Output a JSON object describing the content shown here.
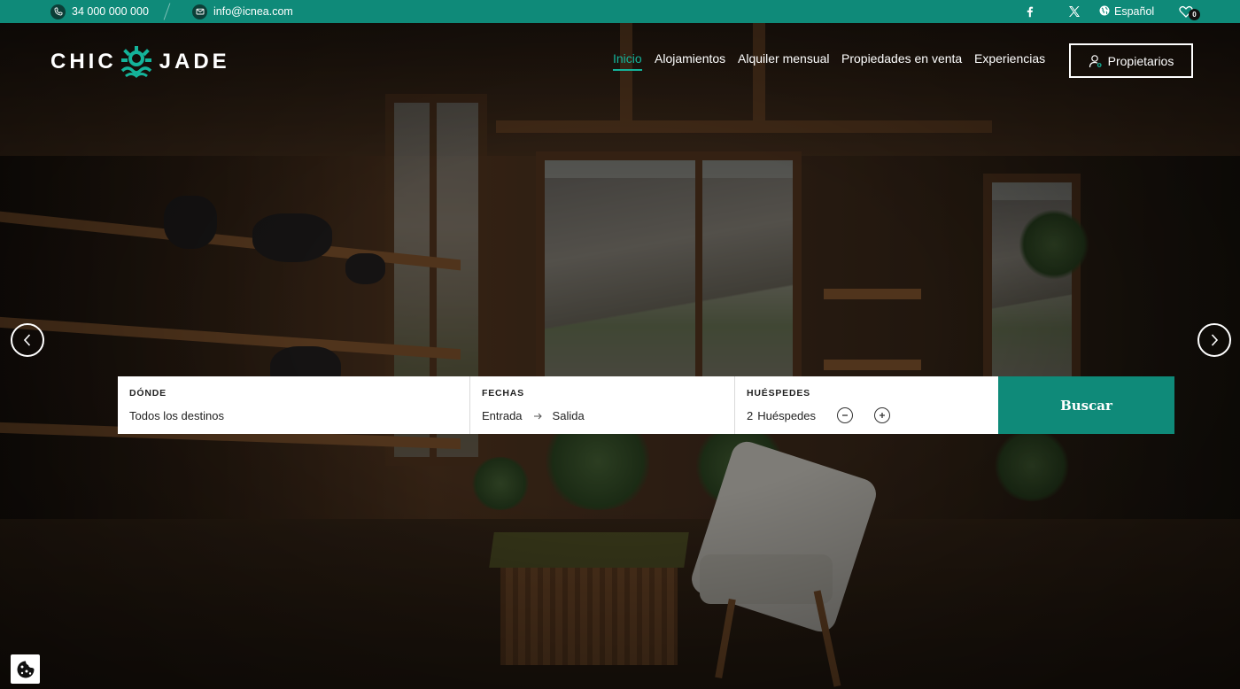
{
  "topbar": {
    "phone": "34 000 000 000",
    "email": "info@icnea.com",
    "language": "Español",
    "favorites_count": "0",
    "bg_color": "#0f8a79",
    "icons": [
      "phone-icon",
      "email-icon",
      "facebook-icon",
      "x-twitter-icon",
      "globe-icon",
      "heart-icon"
    ]
  },
  "header": {
    "logo_left": "CHIC",
    "logo_right": "JADE",
    "nav": [
      {
        "label": "Inicio",
        "active": true
      },
      {
        "label": "Alojamientos",
        "active": false
      },
      {
        "label": "Alquiler mensual",
        "active": false
      },
      {
        "label": "Propiedades en venta",
        "active": false
      },
      {
        "label": "Experiencias",
        "active": false
      }
    ],
    "owners_button": "Propietarios",
    "accent_color": "#14b39a"
  },
  "search": {
    "where_label": "DÓNDE",
    "where_value": "Todos los destinos",
    "dates_label": "FECHAS",
    "checkin": "Entrada",
    "checkout": "Salida",
    "guests_label": "HUÉSPEDES",
    "guests_count": "2",
    "guests_unit": "Huéspedes",
    "submit_label": "Buscar"
  },
  "carousel": {
    "prev_icon": "chevron-left-icon",
    "next_icon": "chevron-right-icon"
  },
  "cookie": {
    "icon": "cookie-icon"
  }
}
